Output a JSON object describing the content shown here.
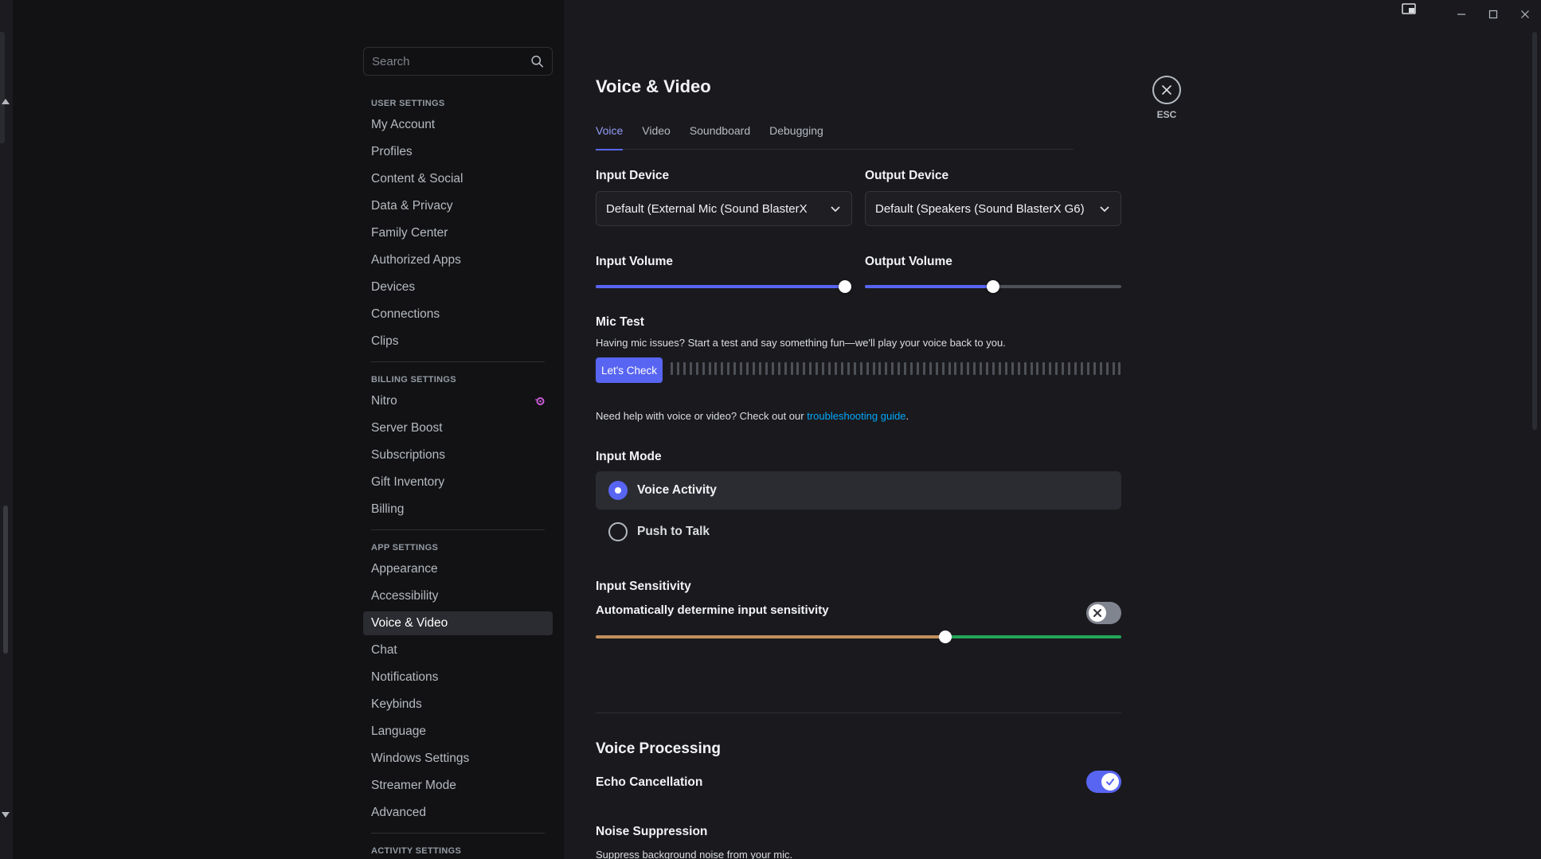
{
  "search": {
    "placeholder": "Search"
  },
  "sidebar": {
    "sections": [
      {
        "title": "USER SETTINGS",
        "items": [
          "My Account",
          "Profiles",
          "Content & Social",
          "Data & Privacy",
          "Family Center",
          "Authorized Apps",
          "Devices",
          "Connections",
          "Clips"
        ]
      },
      {
        "title": "BILLING SETTINGS",
        "items": [
          "Nitro",
          "Server Boost",
          "Subscriptions",
          "Gift Inventory",
          "Billing"
        ]
      },
      {
        "title": "APP SETTINGS",
        "items": [
          "Appearance",
          "Accessibility",
          "Voice & Video",
          "Chat",
          "Notifications",
          "Keybinds",
          "Language",
          "Windows Settings",
          "Streamer Mode",
          "Advanced"
        ]
      },
      {
        "title": "ACTIVITY SETTINGS",
        "items": []
      }
    ],
    "active_item": "Voice & Video"
  },
  "page": {
    "title": "Voice & Video",
    "tabs": [
      "Voice",
      "Video",
      "Soundboard",
      "Debugging"
    ],
    "active_tab": "Voice",
    "close_label": "ESC"
  },
  "devices": {
    "input_label": "Input Device",
    "input_value": "Default (External Mic (Sound BlasterX",
    "output_label": "Output Device",
    "output_value": "Default (Speakers (Sound BlasterX G6)"
  },
  "volume": {
    "input_label": "Input Volume",
    "input_level": 0.985,
    "output_label": "Output Volume",
    "output_level": 0.5
  },
  "mic_test": {
    "label": "Mic Test",
    "description": "Having mic issues? Start a test and say something fun—we'll play your voice back to you.",
    "button": "Let's Check"
  },
  "help": {
    "text_before": "Need help with voice or video? Check out our ",
    "link": "troubleshooting guide",
    "text_after": "."
  },
  "input_mode": {
    "label": "Input Mode",
    "options": [
      "Voice Activity",
      "Push to Talk"
    ],
    "selected": "Voice Activity"
  },
  "sensitivity": {
    "label": "Input Sensitivity",
    "auto_label": "Automatically determine input sensitivity",
    "auto_enabled": false,
    "level": 0.665
  },
  "voice_processing": {
    "title": "Voice Processing",
    "echo_label": "Echo Cancellation",
    "echo_enabled": true,
    "noise_label": "Noise Suppression",
    "noise_desc": "Suppress background noise from your mic."
  },
  "colors": {
    "accent": "#5865f2",
    "link": "#00a8fc",
    "sensitivity_low": "#c28f5c",
    "sensitivity_high": "#23a55a",
    "nitro": "#c95bd6"
  }
}
